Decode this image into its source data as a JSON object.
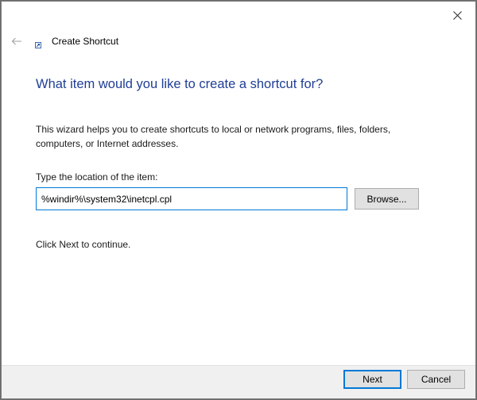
{
  "window": {
    "title": "Create Shortcut",
    "close_icon": "close-icon",
    "back_icon": "back-arrow-icon",
    "shortcut_icon": "shortcut-icon"
  },
  "main": {
    "heading": "What item would you like to create a shortcut for?",
    "description": "This wizard helps you to create shortcuts to local or network programs, files, folders, computers, or Internet addresses.",
    "location_label": "Type the location of the item:",
    "location_value": "%windir%\\system32\\inetcpl.cpl",
    "browse_label": "Browse...",
    "continue_text": "Click Next to continue."
  },
  "footer": {
    "next_label": "Next",
    "cancel_label": "Cancel"
  },
  "colors": {
    "heading": "#1f3e96",
    "accent": "#0078d7",
    "footer_bg": "#f0f0f0"
  }
}
